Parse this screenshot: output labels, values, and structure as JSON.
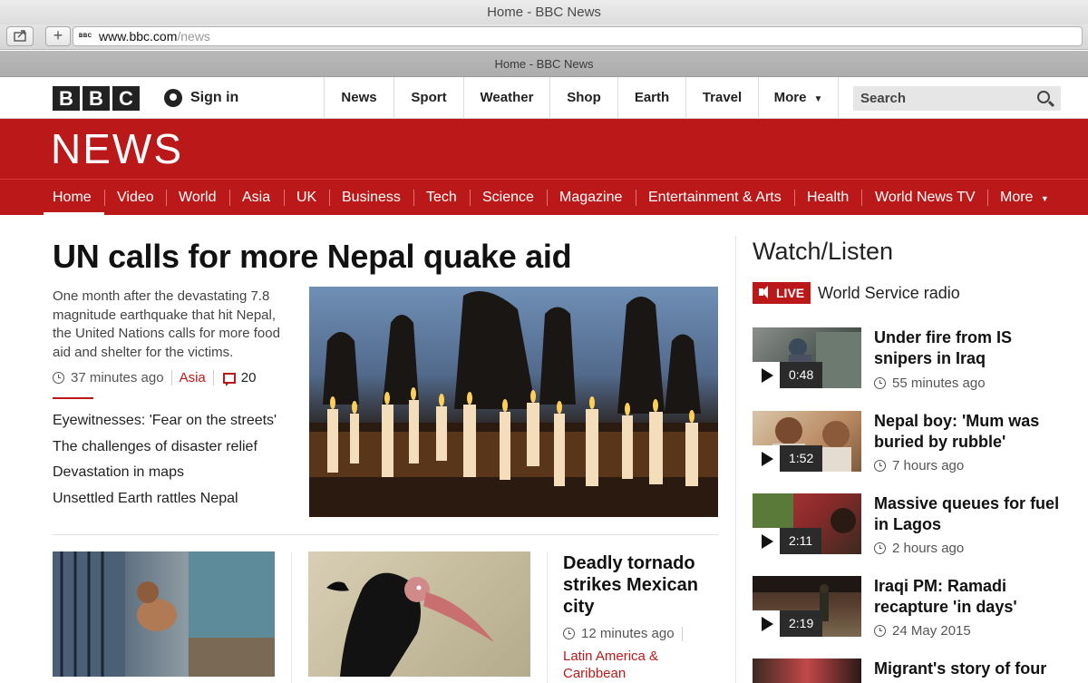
{
  "browser": {
    "window_title": "Home - BBC News",
    "tab_title": "Home - BBC News",
    "url_host": "www.bbc.com",
    "url_path": "/news",
    "favicon_text": "BBC"
  },
  "global_nav": {
    "logo_letters": [
      "B",
      "B",
      "C"
    ],
    "sign_in": "Sign in",
    "items": [
      "News",
      "Sport",
      "Weather",
      "Shop",
      "Earth",
      "Travel",
      "More"
    ],
    "search_placeholder": "Search"
  },
  "masthead": {
    "title": "NEWS"
  },
  "news_nav": {
    "items": [
      "Home",
      "Video",
      "World",
      "Asia",
      "UK",
      "Business",
      "Tech",
      "Science",
      "Magazine",
      "Entertainment & Arts",
      "Health",
      "World News TV",
      "More"
    ],
    "active": "Home"
  },
  "top_story": {
    "headline": "UN calls for more Nepal quake aid",
    "summary": "One month after the devastating 7.8 magnitude earthquake that hit Nepal, the United Nations calls for more food aid and shelter for the victims.",
    "time": "37 minutes ago",
    "section": "Asia",
    "comments": "20",
    "related": [
      "Eyewitnesses: 'Fear on the streets'",
      "The challenges of disaster relief",
      "Devastation in maps",
      "Unsettled Earth rattles Nepal"
    ]
  },
  "secondary_story": {
    "headline": "Deadly tornado strikes Mexican city",
    "time": "12 minutes ago",
    "section": "Latin America & Caribbean"
  },
  "watch_listen": {
    "title": "Watch/Listen",
    "live_badge": "LIVE",
    "live_label": "World Service radio",
    "videos": [
      {
        "title": "Under fire from IS snipers in Iraq",
        "duration": "0:48",
        "time": "55 minutes ago"
      },
      {
        "title": "Nepal boy: 'Mum was buried by rubble'",
        "duration": "1:52",
        "time": "7 hours ago"
      },
      {
        "title": "Massive queues for fuel in Lagos",
        "duration": "2:11",
        "time": "2 hours ago"
      },
      {
        "title": "Iraqi PM: Ramadi recapture 'in days'",
        "duration": "2:19",
        "time": "24 May 2015"
      },
      {
        "title": "Migrant's story of four",
        "duration": "",
        "time": ""
      }
    ]
  },
  "colors": {
    "bbc_red": "#bb1919",
    "live_red": "#bb1919"
  }
}
